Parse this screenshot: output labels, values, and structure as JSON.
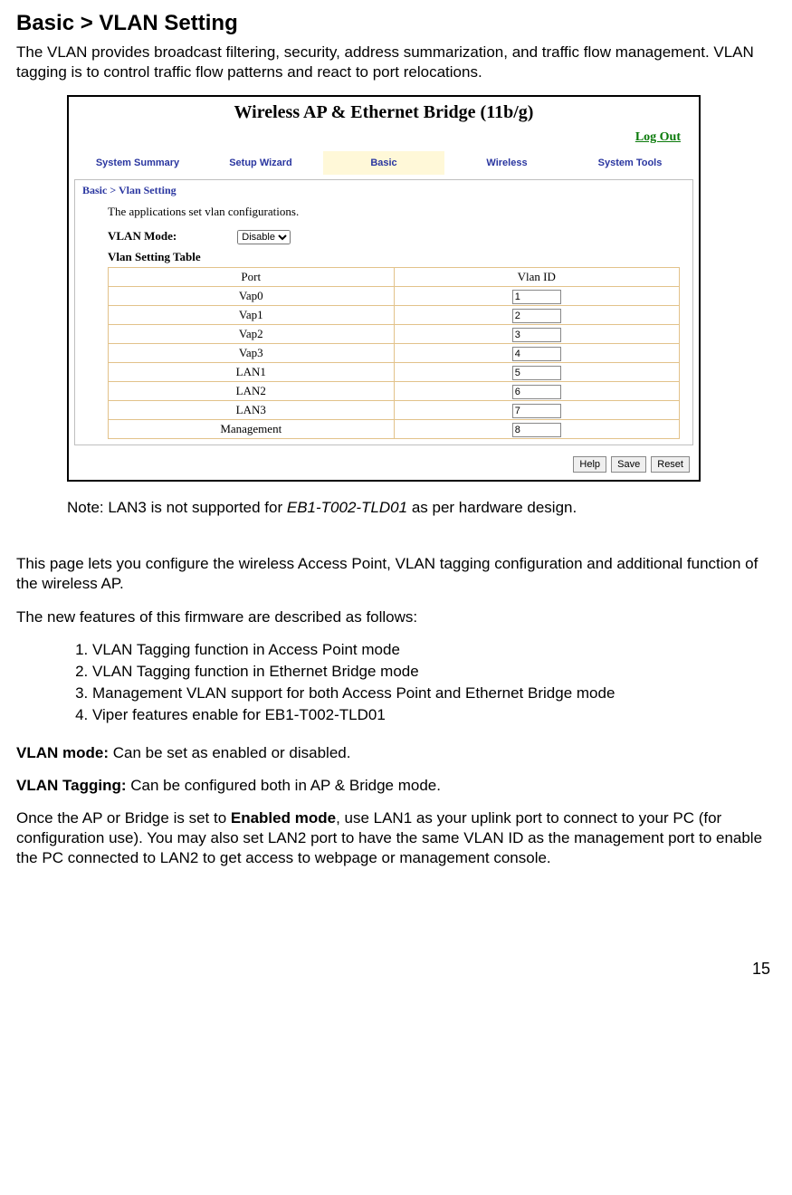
{
  "heading": "Basic > VLAN Setting",
  "intro": "The VLAN provides broadcast filtering, security, address summarization, and traffic flow management. VLAN tagging is to control traffic flow patterns and react to port relocations.",
  "router": {
    "title": "Wireless AP & Ethernet Bridge (11b/g)",
    "logout": "Log Out",
    "tabs": [
      "System Summary",
      "Setup Wizard",
      "Basic",
      "Wireless",
      "System Tools"
    ],
    "breadcrumb": "Basic > Vlan Setting",
    "appline": "The applications set vlan configurations.",
    "mode_label": "VLAN Mode:",
    "mode_value": "Disable",
    "table_caption": "Vlan Setting Table",
    "col_port": "Port",
    "col_vlan": "Vlan ID",
    "rows": [
      {
        "port": "Vap0",
        "id": "1"
      },
      {
        "port": "Vap1",
        "id": "2"
      },
      {
        "port": "Vap2",
        "id": "3"
      },
      {
        "port": "Vap3",
        "id": "4"
      },
      {
        "port": "LAN1",
        "id": "5"
      },
      {
        "port": "LAN2",
        "id": "6"
      },
      {
        "port": "LAN3",
        "id": "7"
      },
      {
        "port": "Management",
        "id": "8"
      }
    ],
    "buttons": {
      "help": "Help",
      "save": "Save",
      "reset": "Reset"
    }
  },
  "note_prefix": "Note: LAN3 is not supported for ",
  "note_italic": "EB1-T002-TLD01",
  "note_suffix": " as per hardware design.",
  "config_para": "This page lets you configure the wireless Access Point, VLAN tagging configuration and additional function of the wireless AP.",
  "features_intro": "The new features of this firmware are described as follows:",
  "features": [
    "VLAN Tagging function in Access Point mode",
    "VLAN Tagging function in Ethernet Bridge mode",
    "Management VLAN support for both Access Point and Ethernet Bridge mode",
    "Viper features enable for EB1-T002-TLD01"
  ],
  "defs": {
    "mode_label": "VLAN mode:",
    "mode_text": " Can be set as enabled or disabled.",
    "tag_label": "VLAN Tagging:",
    "tag_text": " Can be configured both in AP & Bridge mode.",
    "enabled_pre": "Once the AP or Bridge is set to ",
    "enabled_bold": "Enabled mode",
    "enabled_post": ", use LAN1 as your uplink port to connect to your PC (for configuration use). You may may also set LAN2 port to have the same VLAN ID as the management port to enable the PC connected to LAN2 to get access to webpage or management console."
  },
  "enabled_post_fixed": ", use LAN1 as your uplink port to connect to your PC (for configuration use). You may also set LAN2 port to have the same VLAN ID as the management port to enable the PC connected to LAN2 to get access to webpage or management console.",
  "page_number": "15"
}
